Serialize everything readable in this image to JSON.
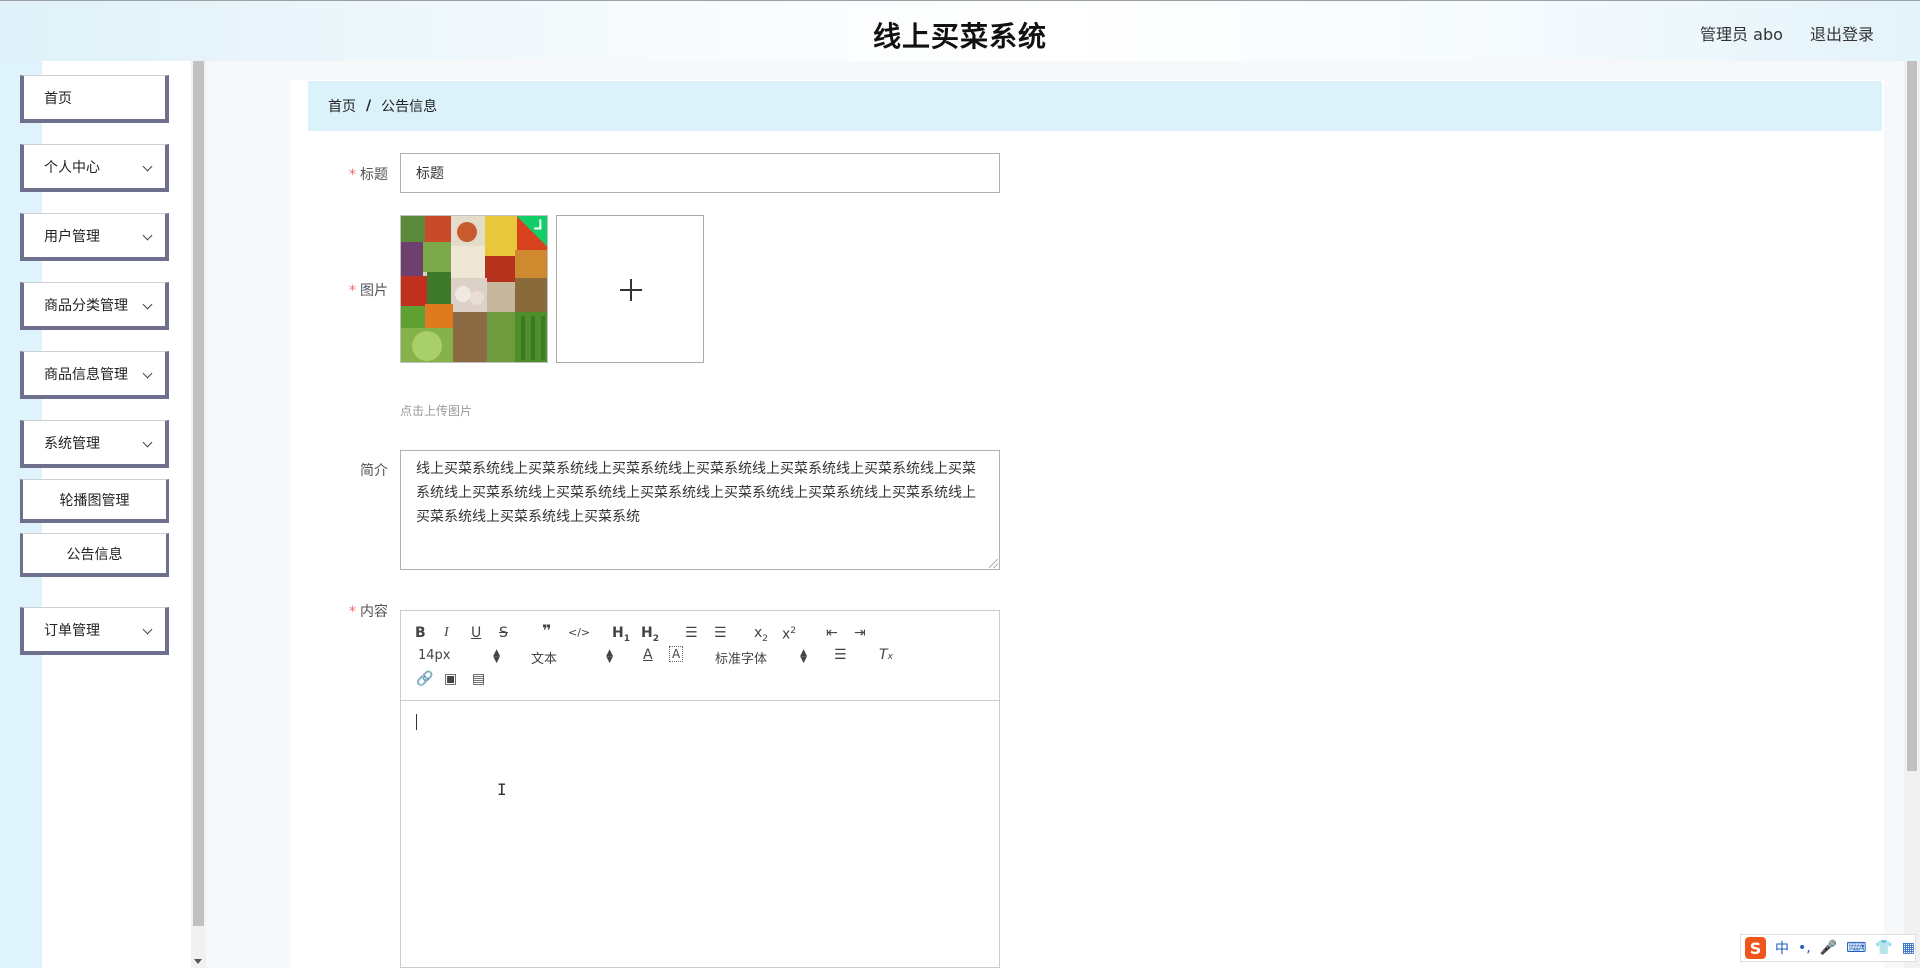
{
  "header": {
    "title": "线上买菜系统",
    "user_label": "管理员 abo",
    "logout_label": "退出登录"
  },
  "sidebar": {
    "items": [
      {
        "label": "首页",
        "has_children": false
      },
      {
        "label": "个人中心",
        "has_children": true
      },
      {
        "label": "用户管理",
        "has_children": true
      },
      {
        "label": "商品分类管理",
        "has_children": true
      },
      {
        "label": "商品信息管理",
        "has_children": true
      },
      {
        "label": "系统管理",
        "has_children": true
      },
      {
        "label": "轮播图管理",
        "sub": true
      },
      {
        "label": "公告信息",
        "sub": true
      },
      {
        "label": "订单管理",
        "has_children": true
      }
    ]
  },
  "breadcrumb": {
    "home": "首页",
    "separator": "/",
    "current": "公告信息"
  },
  "form": {
    "title_label": "标题",
    "title_value": "标题",
    "image_label": "图片",
    "upload_tip": "点击上传图片",
    "intro_label": "简介",
    "intro_value": "线上买菜系统线上买菜系统线上买菜系统线上买菜系统线上买菜系统线上买菜系统线上买菜系统线上买菜系统线上买菜系统线上买菜系统线上买菜系统线上买菜系统线上买菜系统线上买菜系统线上买菜系统线上买菜系统",
    "content_label": "内容"
  },
  "editor": {
    "font_size": "14px",
    "header_select": "文本",
    "font_family": "标准字体"
  },
  "ime": {
    "logo": "S",
    "lang": "中"
  },
  "colors": {
    "required": "#f56c6c",
    "breadcrumb_bg": "#dcf2fb",
    "menu_border": "#6f6f8e",
    "upload_success": "#13ce66"
  }
}
